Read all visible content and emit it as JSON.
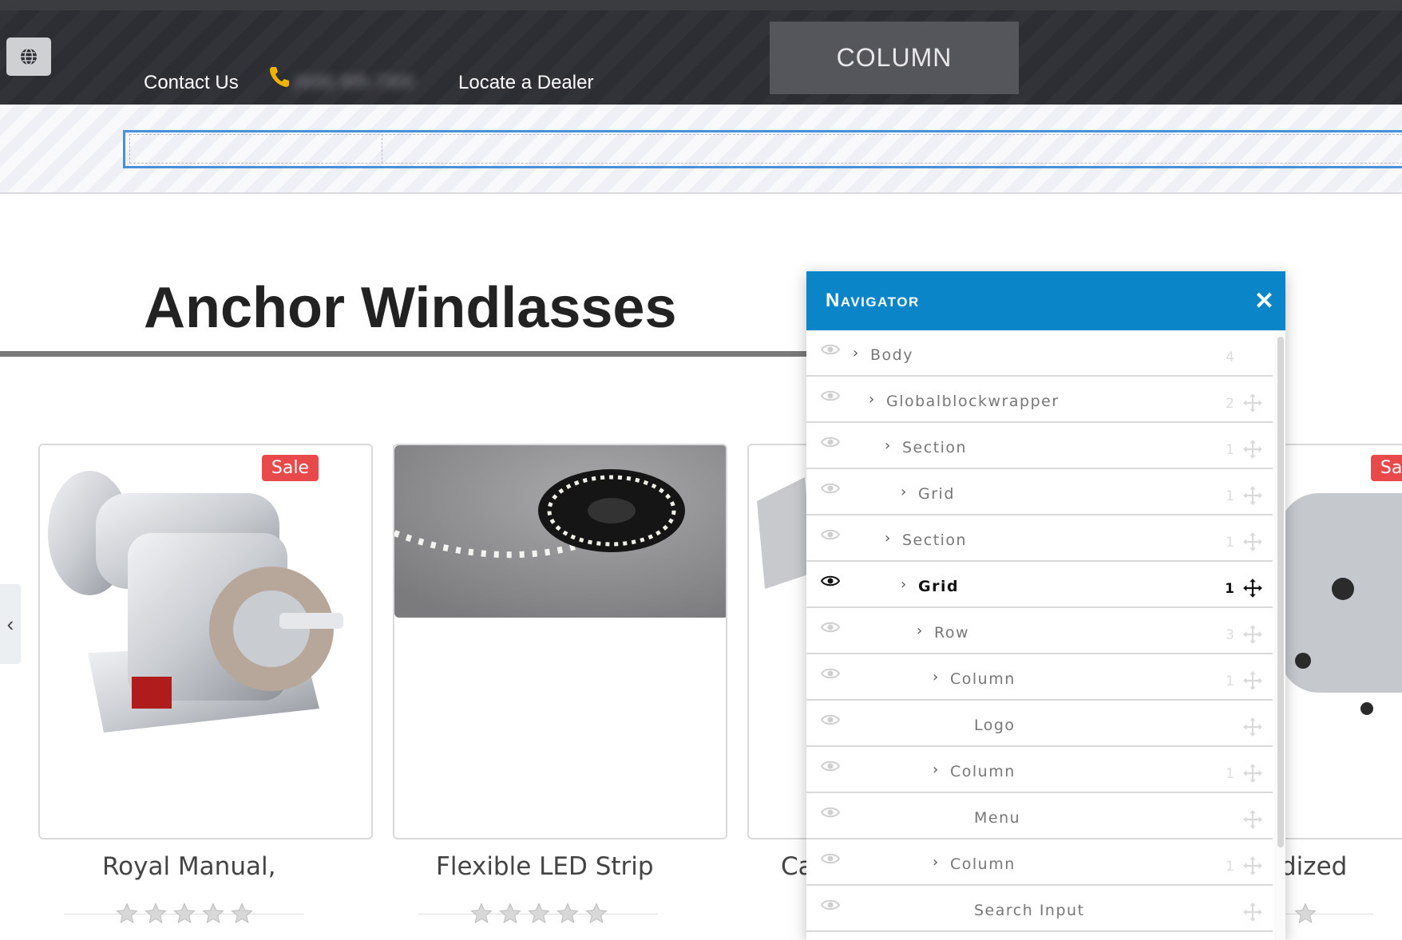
{
  "header": {
    "contact_label": "Contact Us",
    "phone_number": "(608) 995-7300",
    "dealer_label": "Locate a Dealer",
    "column_badge": "COLUMN"
  },
  "page": {
    "title": "Anchor Windlasses"
  },
  "products": [
    {
      "name": "Royal Manual,",
      "badge": "Sale",
      "stars": 0
    },
    {
      "name": "Flexible LED Strip",
      "badge": "",
      "stars": 0
    },
    {
      "name": "Ca",
      "badge": "",
      "stars": 0
    },
    {
      "name": "dized",
      "badge": "Sale",
      "stars": 0
    }
  ],
  "navigator": {
    "title": "Navigator",
    "close_symbol": "✕",
    "items": [
      {
        "label": "Body",
        "count": "4"
      },
      {
        "label": "Globalblockwrapper",
        "count": "2"
      },
      {
        "label": "Section",
        "count": "1"
      },
      {
        "label": "Grid",
        "count": "1"
      },
      {
        "label": "Section",
        "count": "1"
      },
      {
        "label": "Grid",
        "count": "1"
      },
      {
        "label": "Row",
        "count": "3"
      },
      {
        "label": "Column",
        "count": "1"
      },
      {
        "label": "Logo",
        "count": ""
      },
      {
        "label": "Column",
        "count": "1"
      },
      {
        "label": "Menu",
        "count": ""
      },
      {
        "label": "Column",
        "count": "1"
      },
      {
        "label": "Search Input",
        "count": ""
      }
    ]
  },
  "colors": {
    "header_bg": "#2d2e33",
    "accent": "#0a86c8",
    "selection": "#4a90d9",
    "sale": "#e8494a",
    "phone_icon": "#f0b400"
  },
  "icons": {
    "globe": "globe-icon",
    "phone": "phone-icon",
    "eye": "eye-icon",
    "chevron": "chevron-right-icon",
    "move": "move-icon",
    "close": "close-icon",
    "star": "star-icon",
    "arrow": "chevron-left-icon"
  }
}
